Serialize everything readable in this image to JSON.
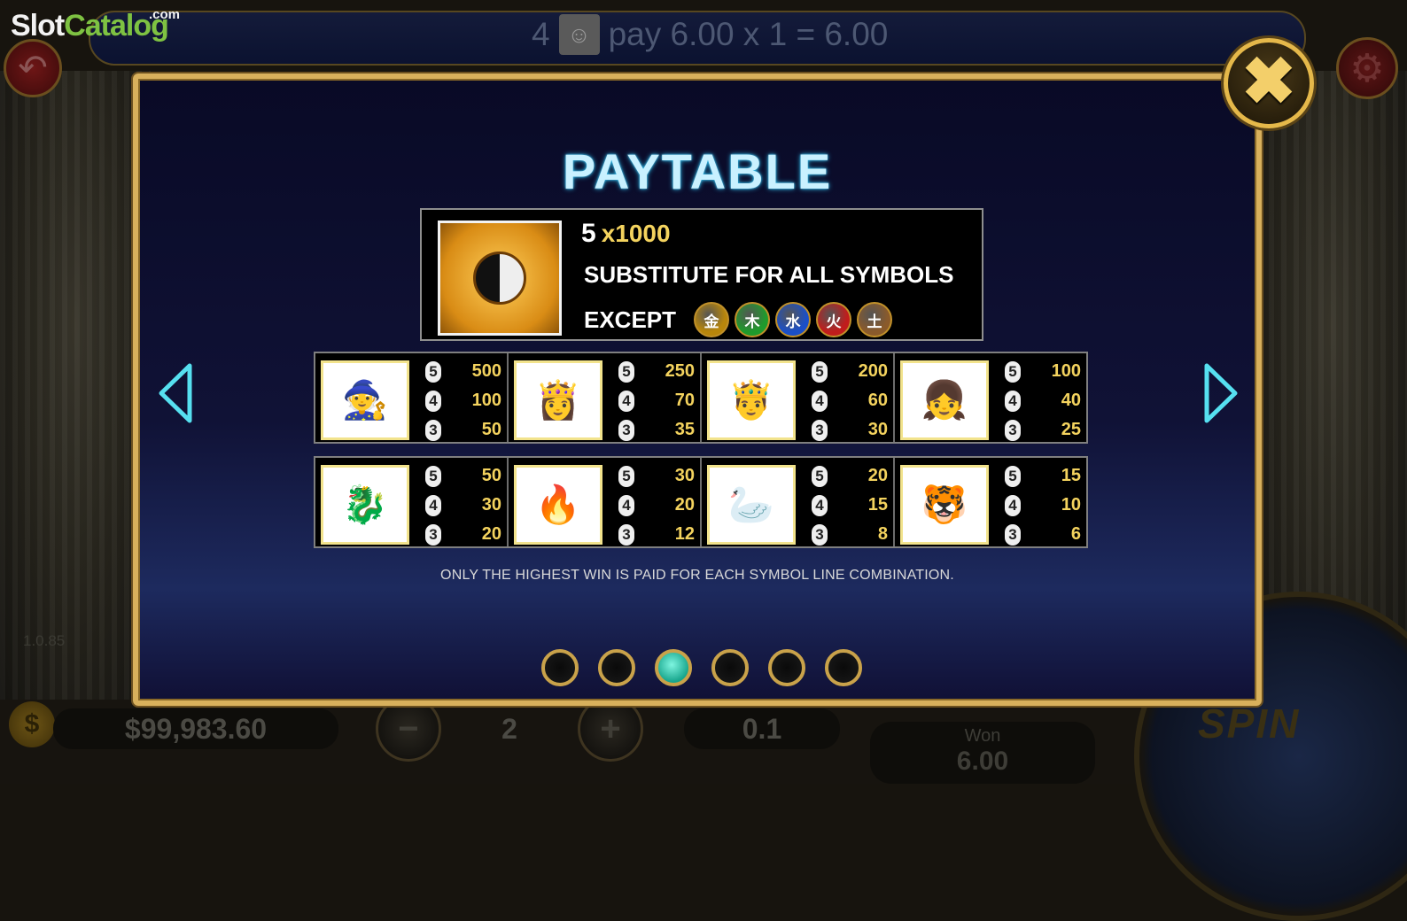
{
  "logo": {
    "part1": "Slot",
    "part2": "Catalog",
    "suffix": ".com"
  },
  "top_bar": {
    "count": "4",
    "text": "pay 6.00 x 1 = 6.00"
  },
  "version": "1.0.85",
  "bottom": {
    "balance": "$99,983.60",
    "lines": "2",
    "bet": "0.1",
    "won_label": "Won",
    "won_value": "6.00",
    "spin_label": "SPIN",
    "coin_symbol": "$",
    "minus": "−",
    "plus": "+"
  },
  "paytable": {
    "title": "PAYTABLE",
    "wild": {
      "count": "5",
      "multiplier": "x1000",
      "line2": "SUBSTITUTE FOR ALL SYMBOLS",
      "except_label": "EXCEPT",
      "except_orbs": [
        {
          "glyph": "金",
          "color": "#b8860b"
        },
        {
          "glyph": "木",
          "color": "#1f9a2c"
        },
        {
          "glyph": "水",
          "color": "#1b4fc7"
        },
        {
          "glyph": "火",
          "color": "#c11c1c"
        },
        {
          "glyph": "土",
          "color": "#8a5a2b"
        }
      ]
    },
    "row1": [
      {
        "icon": "old-sage-icon",
        "glyph": "🧙",
        "pays": [
          "500",
          "100",
          "50"
        ]
      },
      {
        "icon": "warrior-woman-icon",
        "glyph": "👸",
        "pays": [
          "250",
          "70",
          "35"
        ]
      },
      {
        "icon": "swordsman-icon",
        "glyph": "🤴",
        "pays": [
          "200",
          "60",
          "30"
        ]
      },
      {
        "icon": "girl-icon",
        "glyph": "👧",
        "pays": [
          "100",
          "40",
          "25"
        ]
      }
    ],
    "row2": [
      {
        "icon": "dragon-icon",
        "glyph": "🐉",
        "pays": [
          "50",
          "30",
          "20"
        ]
      },
      {
        "icon": "phoenix-icon",
        "glyph": "🔥",
        "pays": [
          "30",
          "20",
          "12"
        ]
      },
      {
        "icon": "crane-icon",
        "glyph": "🦢",
        "pays": [
          "20",
          "15",
          "8"
        ]
      },
      {
        "icon": "blue-tiger-icon",
        "glyph": "🐯",
        "pays": [
          "15",
          "10",
          "6"
        ]
      }
    ],
    "counts": [
      "5",
      "4",
      "3"
    ],
    "note": "ONLY THE HIGHEST WIN IS PAID FOR EACH SYMBOL LINE COMBINATION.",
    "pages": 6,
    "active_page": 3,
    "close_glyph": "✖"
  },
  "colors": {
    "gold": "#f4d35e",
    "frame": "#d8b05c",
    "title_glow": "#2ab6e4"
  }
}
